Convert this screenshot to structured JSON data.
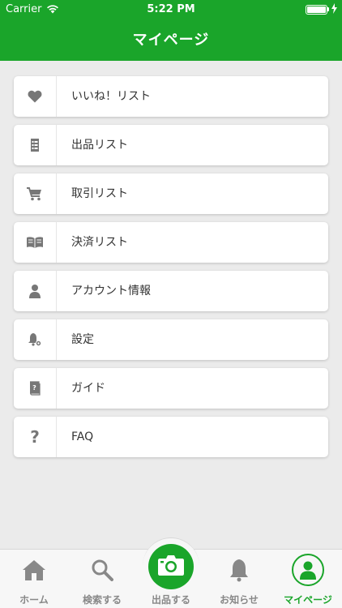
{
  "status_bar": {
    "carrier": "Carrier",
    "time": "5:22 PM"
  },
  "header": {
    "title": "マイページ"
  },
  "menu": [
    {
      "label": "いいね！リスト",
      "icon": "heart-icon"
    },
    {
      "label": "出品リスト",
      "icon": "list-document-icon"
    },
    {
      "label": "取引リスト",
      "icon": "cart-icon"
    },
    {
      "label": "決済リスト",
      "icon": "open-book-icon"
    },
    {
      "label": "アカウント情報",
      "icon": "person-icon"
    },
    {
      "label": "設定",
      "icon": "bell-gear-icon"
    },
    {
      "label": "ガイド",
      "icon": "guide-book-icon"
    },
    {
      "label": "FAQ",
      "icon": "question-icon",
      "glyph": "?"
    }
  ],
  "tabbar": {
    "tabs": [
      {
        "label": "ホーム",
        "icon": "home-icon"
      },
      {
        "label": "検索する",
        "icon": "search-icon"
      },
      {
        "label": "出品する",
        "icon": "camera-icon"
      },
      {
        "label": "お知らせ",
        "icon": "bell-icon"
      },
      {
        "label": "マイページ",
        "icon": "profile-icon",
        "active": true
      }
    ]
  },
  "colors": {
    "brand": "#1aa52a",
    "icon_gray": "#777777",
    "background": "#ebebeb"
  }
}
